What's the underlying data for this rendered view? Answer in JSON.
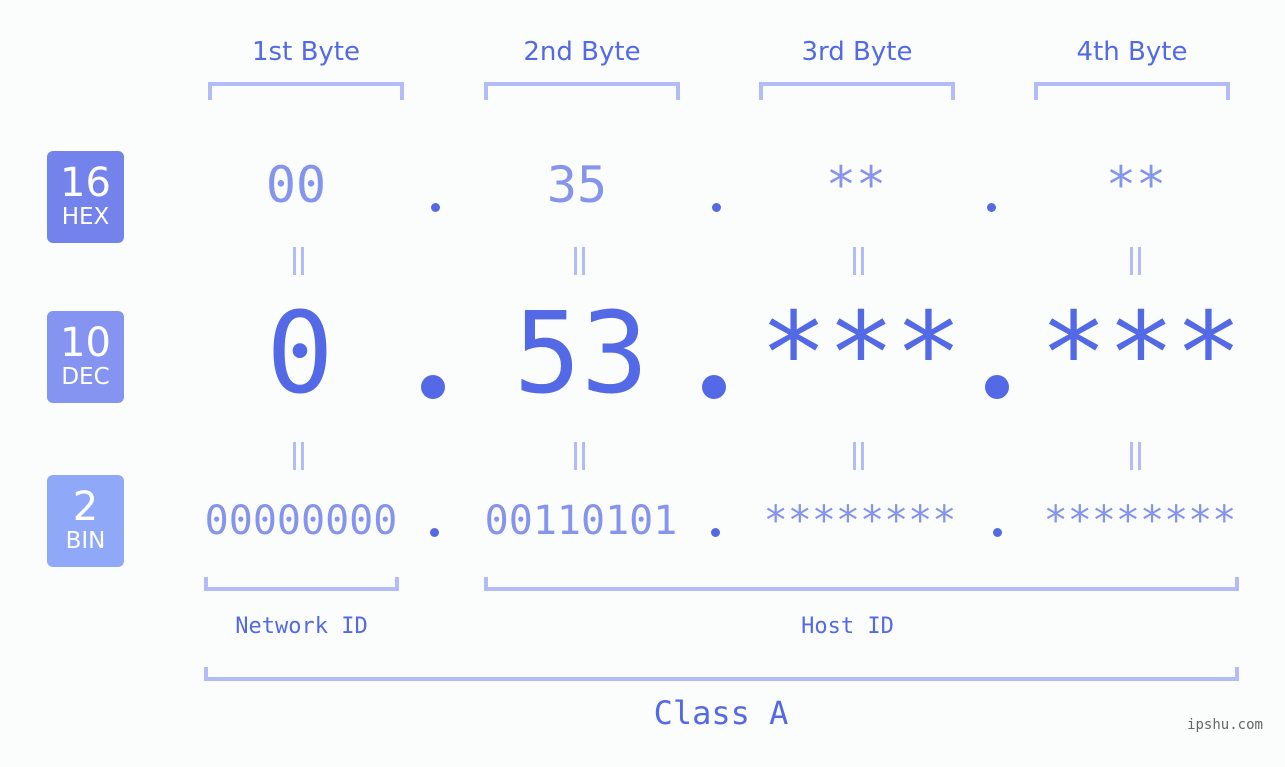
{
  "colors": {
    "accent": "#5369e6",
    "light_accent": "#8594ec",
    "bracket": "#b3bcf7",
    "hex_badge": "#7383eb",
    "dec_badge": "#8494f0",
    "bin_badge": "#90a8f8",
    "background": "#fbfdfc"
  },
  "byte_headers": [
    "1st Byte",
    "2nd Byte",
    "3rd Byte",
    "4th Byte"
  ],
  "bases": [
    {
      "number": "16",
      "label": "HEX"
    },
    {
      "number": "10",
      "label": "DEC"
    },
    {
      "number": "2",
      "label": "BIN"
    }
  ],
  "hex": [
    "00",
    "35",
    "**",
    "**"
  ],
  "dec": [
    "0",
    "53",
    "***",
    "***"
  ],
  "bin": [
    "00000000",
    "00110101",
    "********",
    "********"
  ],
  "separator": ".",
  "network_id_label": "Network ID",
  "host_id_label": "Host ID",
  "class_label": "Class A",
  "watermark": "ipshu.com"
}
